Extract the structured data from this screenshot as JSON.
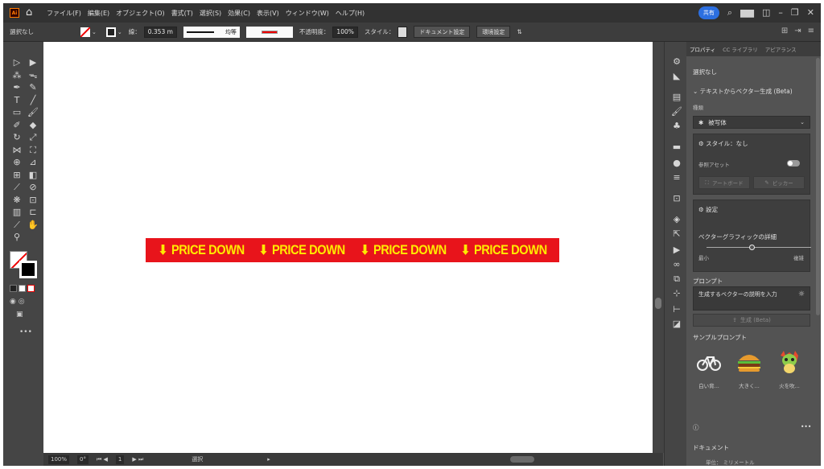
{
  "menubar": {
    "logo": "Ai",
    "items": [
      "ファイル(F)",
      "編集(E)",
      "オブジェクト(O)",
      "書式(T)",
      "選択(S)",
      "効果(C)",
      "表示(V)",
      "ウィンドウ(W)",
      "ヘルプ(H)"
    ],
    "share_label": "共有"
  },
  "controlbar": {
    "selection": "選択なし",
    "stroke_label": "線：",
    "stroke_value": "0.353 m",
    "uniform_label": "均等",
    "opacity_label": "不透明度：",
    "opacity_value": "100%",
    "style_label": "スタイル：",
    "doc_settings": "ドキュメント設定",
    "preferences": "環境設定"
  },
  "canvas": {
    "banner_text": [
      "PRICE DOWN",
      "PRICE DOWN",
      "PRICE DOWN",
      "PRICE DOWN"
    ],
    "banner_color": "#e8141b",
    "banner_text_color": "#ffeb00"
  },
  "statusbar": {
    "zoom": "100%",
    "rotation": "0°",
    "artboard": "1",
    "tool": "選択"
  },
  "panel": {
    "tabs": [
      "プロパティ",
      "CC ライブラリ",
      "アピアランス"
    ],
    "selection": "選択なし",
    "section_title": "テキストからベクター生成 (Beta)",
    "type_label": "種類",
    "type_value": "被写体",
    "style_value": "スタイル：なし",
    "ref_asset": "参照アセット",
    "artboard_btn": "アートボード",
    "picker_btn": "ピッカー",
    "settings": "設定",
    "detail_label": "ベクターグラフィックの詳細",
    "min_label": "最小",
    "max_label": "複雑",
    "prompt_heading": "プロンプト",
    "prompt_placeholder": "生成するベクターの説明を入力",
    "generate_btn": "生成 (Beta)",
    "samples_heading": "サンプルプロンプト",
    "samples": [
      "白い背...",
      "大きく...",
      "火を吹..."
    ],
    "doc_heading": "ドキュメント",
    "unit_label": "単位：",
    "unit_value": "ミリメートル"
  }
}
